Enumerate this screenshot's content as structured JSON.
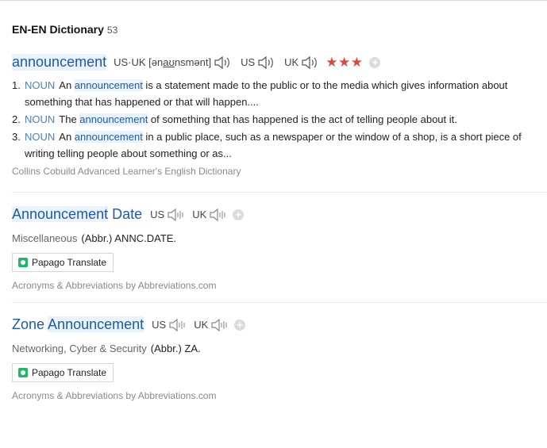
{
  "header": {
    "title": "EN-EN Dictionary",
    "count": "53"
  },
  "entry1": {
    "word": "announcement",
    "pron_prefix": "US·UK [ə",
    "pron_underlined": "n",
    "pron_au": "aʊ",
    "pron_suffix": "nsmənt]",
    "us_label": "US",
    "uk_label": "UK",
    "stars": "★★★",
    "definitions": [
      {
        "num": "1.",
        "pos": "NOUN",
        "pre": "An ",
        "hl": "announcement",
        "post": " is a statement made to the public or to the media which gives information about something that has happened or that will happen...."
      },
      {
        "num": "2.",
        "pos": "NOUN",
        "pre": "The ",
        "hl": "announcement",
        "post": " of something that has happened is the act of telling people about it."
      },
      {
        "num": "3.",
        "pos": "NOUN",
        "pre": "An ",
        "hl": "announcement",
        "post": " in a public place, such as a newspaper or the window of a shop, is a short piece of writing telling people about something or as..."
      }
    ],
    "source": "Collins Cobuild Advanced Learner's English Dictionary"
  },
  "entry2": {
    "word_hl": "Announcement",
    "word_rest": " Date",
    "us_label": "US",
    "uk_label": "UK",
    "category": "Miscellaneous",
    "abbr": "(Abbr.) ANNC.DATE.",
    "papago": "Papago Translate",
    "source": "Acronyms & Abbreviations by Abbreviations.com"
  },
  "entry3": {
    "word_pre": "Zone ",
    "word_hl": "Announcement",
    "us_label": "US",
    "uk_label": "UK",
    "category": "Networking, Cyber & Security",
    "abbr": "(Abbr.) ZA.",
    "papago": "Papago Translate",
    "source": "Acronyms & Abbreviations by Abbreviations.com"
  },
  "icons": {
    "speaker": "speaker-icon",
    "speaker_disabled": "speaker-disabled-icon",
    "plus": "plus-icon",
    "papago": "papago-icon"
  },
  "colors": {
    "link": "#1f5aa6",
    "pos": "#4d7fbf",
    "stars": "#d94a3d",
    "highlight": "#eaf3fb"
  }
}
